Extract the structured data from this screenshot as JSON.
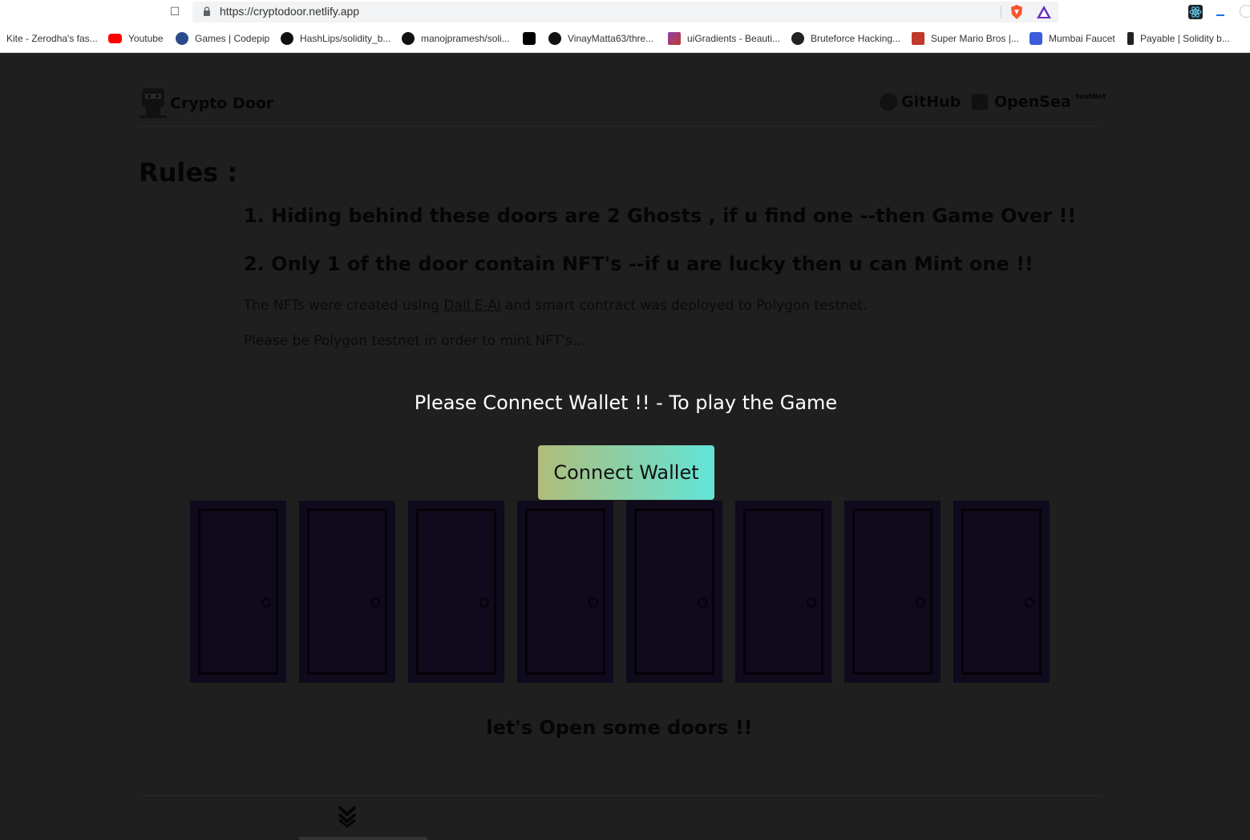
{
  "browser": {
    "url": "https://cryptodoor.netlify.app",
    "bookmarks": [
      {
        "label": "Kite - Zerodha's fas...",
        "icon": "none",
        "color": ""
      },
      {
        "label": "Youtube",
        "icon": "youtube-icon",
        "color": "#ff0000"
      },
      {
        "label": "Games | Codepip",
        "icon": "codepip-icon",
        "color": "#2b4c8c"
      },
      {
        "label": "HashLips/solidity_b...",
        "icon": "github-icon",
        "color": "#111111"
      },
      {
        "label": "manojpramesh/soli...",
        "icon": "github-icon",
        "color": "#111111"
      },
      {
        "label": "",
        "icon": "triangle-app-icon",
        "color": "#000000"
      },
      {
        "label": "VinayMatta63/thre...",
        "icon": "github-icon",
        "color": "#111111"
      },
      {
        "label": "uiGradients - Beauti...",
        "icon": "uigradients-icon",
        "color": "#8e44ad"
      },
      {
        "label": "Bruteforce Hacking...",
        "icon": "bruteforce-icon",
        "color": "#222222"
      },
      {
        "label": "Super Mario Bros |...",
        "icon": "mario-icon",
        "color": "#c0392b"
      },
      {
        "label": "Mumbai Faucet",
        "icon": "polygon-icon",
        "color": "#3b5bdb"
      },
      {
        "label": "Payable | Solidity b...",
        "icon": "dollar-icon",
        "color": "#222222"
      }
    ]
  },
  "nav": {
    "brand": "Crypto Door",
    "github": "GitHub",
    "opensea": "OpenSea",
    "opensea_tag": "testNet"
  },
  "rules": {
    "title": "Rules :",
    "rule1": "1. Hiding behind these doors are 2 Ghosts , if u find one --then Game Over !!",
    "rule2": "2. Only 1 of the door contain NFT's --if u are lucky then u can Mint one !!",
    "info_prefix": "The NFTs were created using ",
    "info_link": "Dall E-Ai",
    "info_suffix": " and smart contract was deployed to Polygon testnet.",
    "note": "Please be Polygon testnet in order to mint NFT's...."
  },
  "wallet": {
    "prompt": "Please Connect Wallet !! - To play the Game",
    "button": "Connect Wallet"
  },
  "doors": {
    "count": 8
  },
  "footer": {
    "cta": "let's Open some doors !!"
  },
  "colors": {
    "page_bg": "#1f1f1f",
    "door": "#0f0a1c",
    "button_gradient_start": "#b0bd7a",
    "button_gradient_end": "#62e4d8"
  }
}
